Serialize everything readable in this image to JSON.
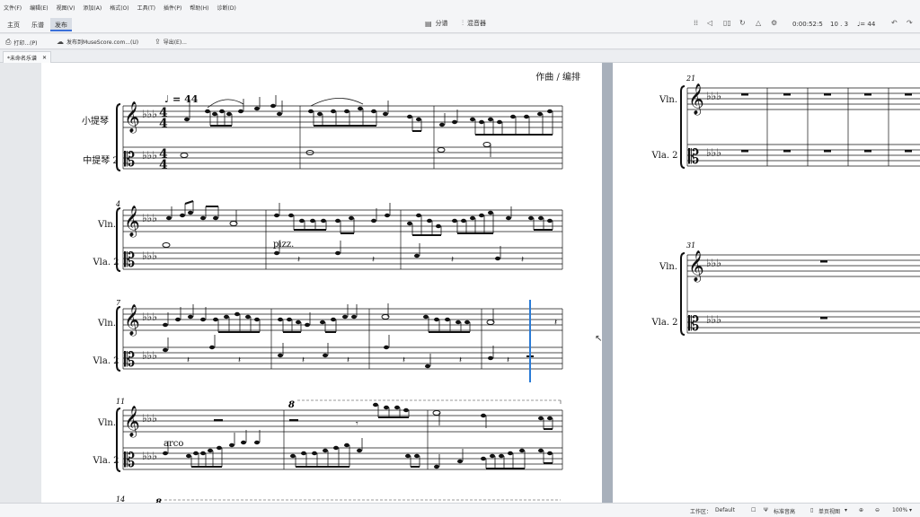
{
  "menu": [
    "文件(F)",
    "编辑(E)",
    "视图(V)",
    "添加(A)",
    "格式(O)",
    "工具(T)",
    "插件(P)",
    "帮助(H)",
    "诊断(D)"
  ],
  "tabs": [
    "主页",
    "乐谱",
    "发布"
  ],
  "toolbar": {
    "parts_label": "分谱",
    "mixer_label": "混音器",
    "time": "0:00:52:5",
    "position": "10 . 3",
    "tempo": "♩= 44"
  },
  "subbar": {
    "print_label": "打印...(P)",
    "publish_label": "发布到MuseScore.com...(U)",
    "export_label": "导出(E)..."
  },
  "doc_tab": "*未命名乐谱",
  "score": {
    "composer": "作曲 / 编排",
    "tempo_mark": "♩ = 44",
    "inst1_full": "小提琴",
    "inst2_full": "中提琴 2",
    "inst1_short": "Vln.",
    "inst2_short": "Vla. 2",
    "m4": "4",
    "m7": "7",
    "m11": "11",
    "m14": "14",
    "m21": "21",
    "m31": "31",
    "pizz": "pizz.",
    "arco": "arco",
    "ottava": "8"
  },
  "status": {
    "workspace_label": "工作区：",
    "workspace_value": "Default",
    "concert_pitch": "标准音高",
    "view_mode": "单页视图",
    "zoom": "100%"
  }
}
